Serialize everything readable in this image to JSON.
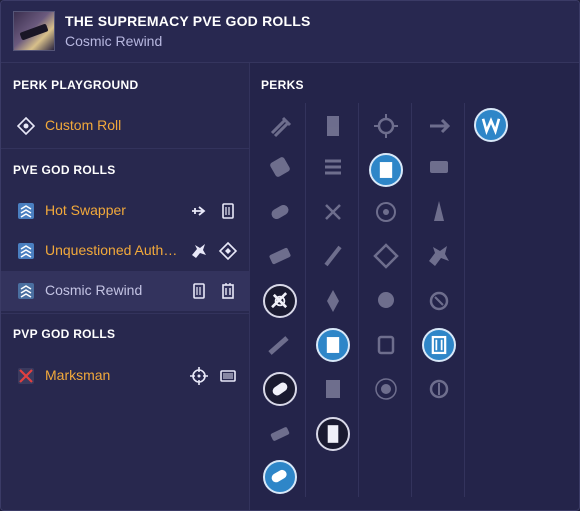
{
  "header": {
    "title": "THE SUPREMACY PVE GOD ROLLS",
    "subtitle": "Cosmic Rewind",
    "thumb_icon": "sniper-rifle-icon"
  },
  "sidebar": {
    "playground": {
      "heading": "PERK PLAYGROUND",
      "custom_label": "Custom Roll"
    },
    "pve": {
      "heading": "PVE GOD ROLLS",
      "items": [
        {
          "label": "Hot Swapper",
          "perks": [
            "arrow-perk-icon",
            "magazine-perk-icon"
          ]
        },
        {
          "label": "Unquestioned Authority",
          "perks": [
            "beast-perk-icon",
            "diamond-perk-icon"
          ]
        },
        {
          "label": "Cosmic Rewind",
          "perks": [
            "magazine-perk-icon",
            "battery-perk-icon"
          ]
        }
      ]
    },
    "pvp": {
      "heading": "PVP GOD ROLLS",
      "items": [
        {
          "label": "Marksman",
          "perks": [
            "crosshair-perk-icon",
            "bars-perk-icon"
          ]
        }
      ]
    }
  },
  "perks": {
    "heading": "PERKS"
  },
  "colors": {
    "accent_orange": "#f2a93b",
    "selected_blue": "#2e86c8",
    "panel_bg": "#24244a"
  }
}
